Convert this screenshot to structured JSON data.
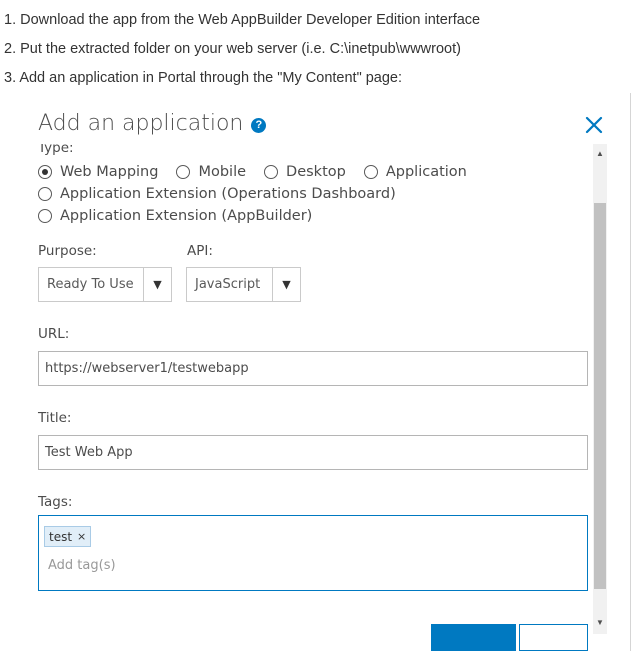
{
  "instructions": [
    "1. Download the app from the Web AppBuilder Developer Edition interface",
    "2. Put the extracted folder on your web server (i.e. C:\\inetpub\\wwwroot)",
    "3. Add an application in Portal through the \"My Content\" page:"
  ],
  "dialog": {
    "title": "Add an application",
    "help_icon": "?",
    "close_icon": "close-icon",
    "type_label": "Type:",
    "type_options": [
      {
        "label": "Web Mapping",
        "checked": true
      },
      {
        "label": "Mobile",
        "checked": false
      },
      {
        "label": "Desktop",
        "checked": false
      },
      {
        "label": "Application",
        "checked": false
      },
      {
        "label": "Application Extension (Operations Dashboard)",
        "checked": false
      },
      {
        "label": "Application Extension (AppBuilder)",
        "checked": false
      }
    ],
    "purpose_label": "Purpose:",
    "purpose_value": "Ready To Use",
    "api_label": "API:",
    "api_value": "JavaScript",
    "dropdown_arrow": "▼",
    "url_label": "URL:",
    "url_value": "https://webserver1/testwebapp",
    "title_label": "Title:",
    "title_value": "Test Web App",
    "tags_label": "Tags:",
    "tags": [
      "test"
    ],
    "tag_remove": "×",
    "tags_placeholder": "Add tag(s)",
    "scroll_up": "▲",
    "scroll_down": "▼"
  },
  "colors": {
    "accent": "#0079c1",
    "text": "#4c4c4c"
  }
}
